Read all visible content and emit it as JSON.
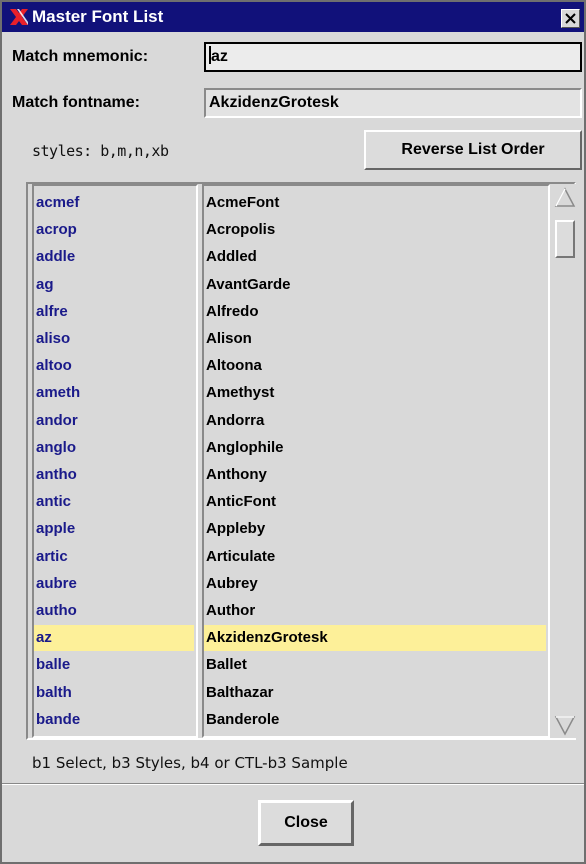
{
  "window": {
    "title": "Master Font List",
    "title_icon": "x-logo-icon",
    "close_icon": "close-icon"
  },
  "form": {
    "mnemonic_label": "Match mnemonic:",
    "mnemonic_value": "az",
    "fontname_label": "Match  fontname:",
    "fontname_value": "AkzidenzGrotesk"
  },
  "styles_text": "styles: b,m,n,xb",
  "reverse_button": "Reverse List Order",
  "list": {
    "mnemonics": [
      "acmef",
      "acrop",
      "addle",
      "ag",
      "alfre",
      "aliso",
      "altoo",
      "ameth",
      "andor",
      "anglo",
      "antho",
      "antic",
      "apple",
      "artic",
      "aubre",
      "autho",
      "az",
      "balle",
      "balth",
      "bande"
    ],
    "fontnames": [
      "AcmeFont",
      "Acropolis",
      "Addled",
      "AvantGarde",
      "Alfredo",
      "Alison",
      "Altoona",
      "Amethyst",
      "Andorra",
      "Anglophile",
      "Anthony",
      "AnticFont",
      "Appleby",
      "Articulate",
      "Aubrey",
      "Author",
      "AkzidenzGrotesk",
      "Ballet",
      "Balthazar",
      "Banderole"
    ],
    "selected_index": 16
  },
  "hint": "b1 Select, b3 Styles, b4 or CTL-b3 Sample",
  "close_button": "Close",
  "colors": {
    "titlebar": "#11117a",
    "selection": "#fdf099",
    "mnemonic_text": "#1a1a8a"
  }
}
